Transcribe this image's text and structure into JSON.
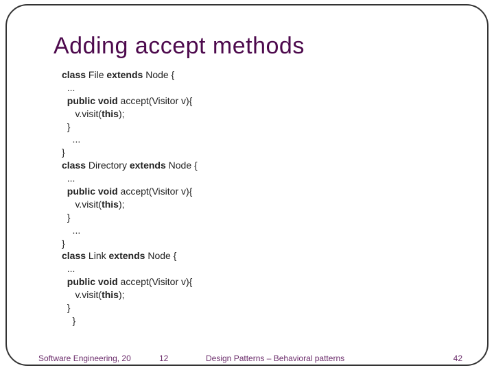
{
  "title": "Adding accept methods",
  "code": {
    "l0": "class",
    "l0b": " File ",
    "l0c": "extends",
    "l0d": " Node {",
    "l1": "  ...",
    "l2a": "  public void",
    "l2b": " accept(Visitor v){",
    "l3a": "     v.visit(",
    "l3b": "this",
    "l3c": ");",
    "l4": "  }",
    "l5": "    ...",
    "l6": "}",
    "l7a": "class",
    "l7b": " Directory ",
    "l7c": "extends",
    "l7d": " Node {",
    "l8": "  ...",
    "l9a": "  public void",
    "l9b": " accept(Visitor v){",
    "l10a": "     v.visit(",
    "l10b": "this",
    "l10c": ");",
    "l11": "  }",
    "l12": "    ...",
    "l13": "}",
    "l14a": "class",
    "l14b": " Link ",
    "l14c": "extends",
    "l14d": " Node {",
    "l15": "  ...",
    "l16a": "  public void",
    "l16b": " accept(Visitor v){",
    "l17a": "     v.visit(",
    "l17b": "this",
    "l17c": ");",
    "l18": "  }",
    "l19": "    }"
  },
  "footer": {
    "left": "Software Engineering, 20",
    "mid1": "12",
    "mid2": "Design Patterns – Behavioral patterns",
    "right": "42"
  }
}
